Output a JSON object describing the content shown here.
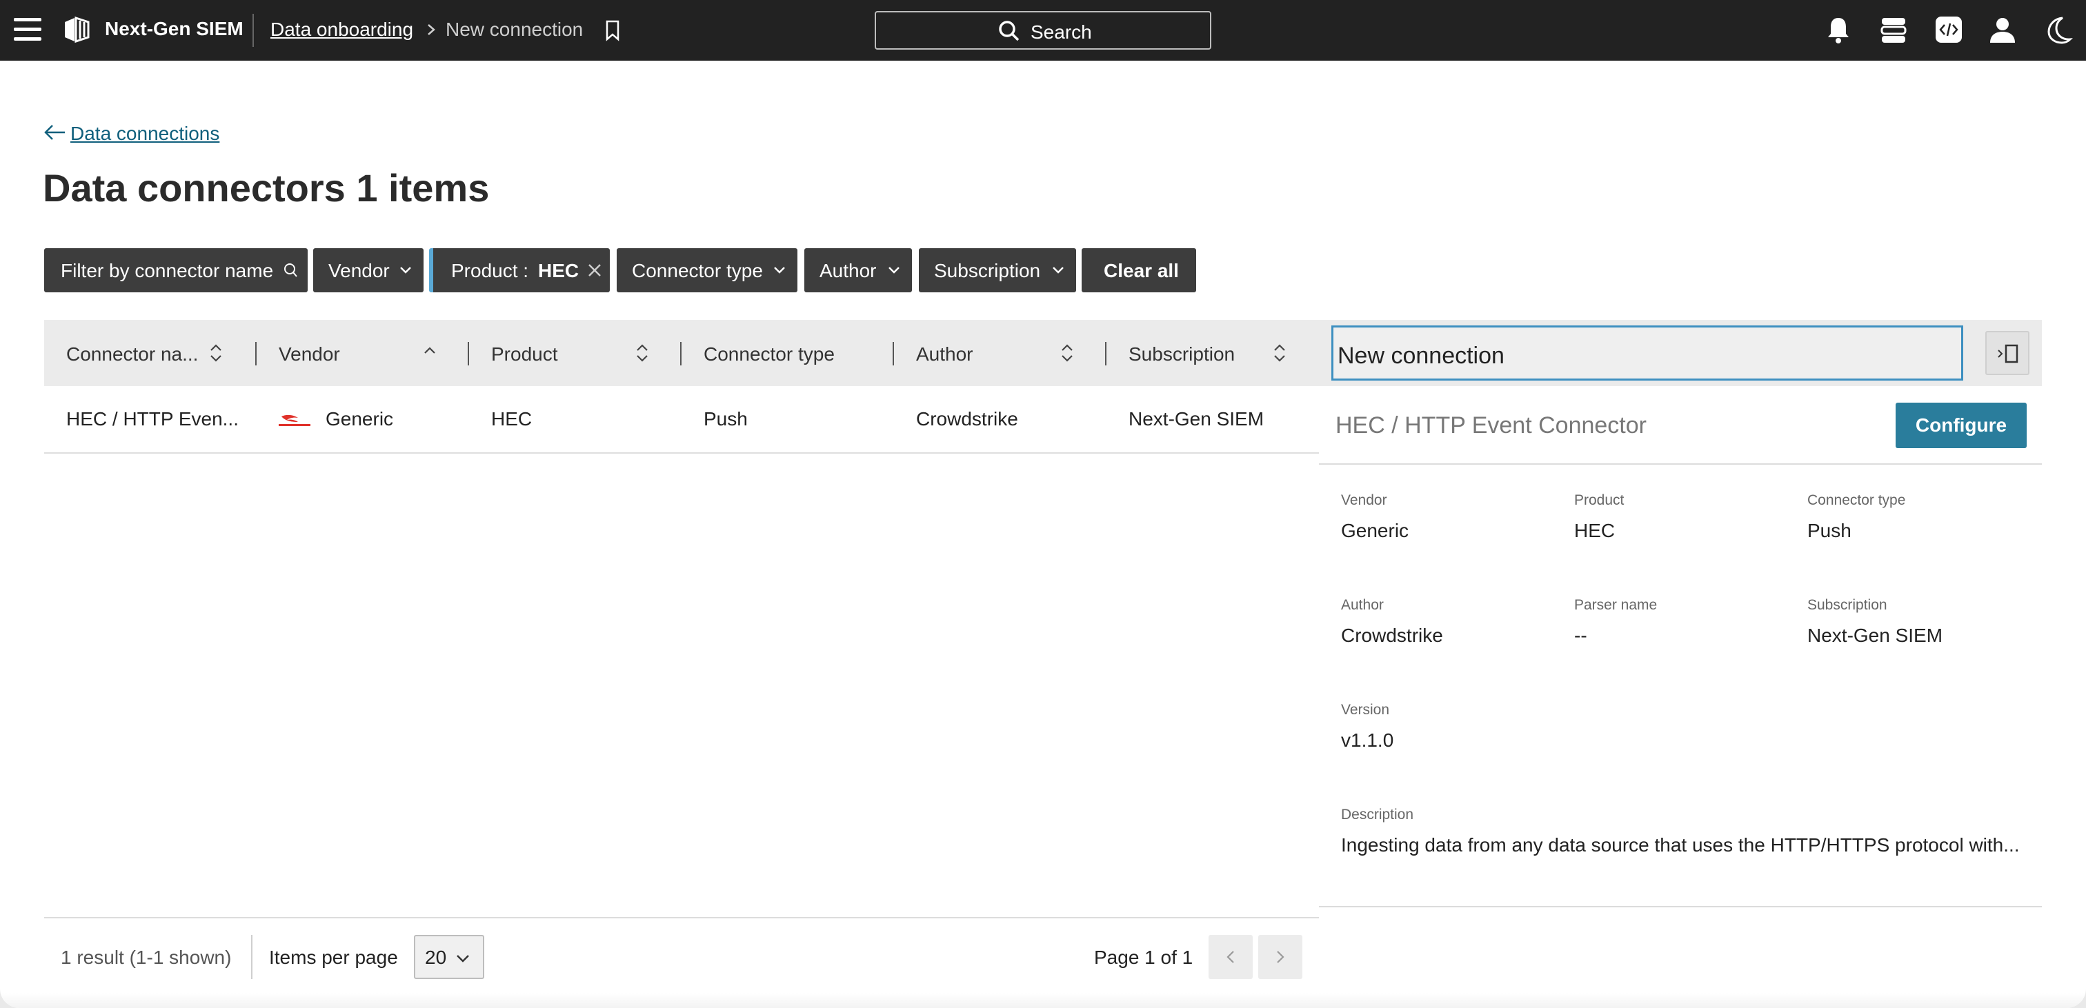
{
  "topbar": {
    "app_name": "Next-Gen SIEM",
    "breadcrumb_link": "Data onboarding",
    "breadcrumb_current": "New connection",
    "search_label": "Search",
    "icons": [
      "menu-icon",
      "app-logo-icon",
      "chevron-right-icon",
      "bookmark-icon",
      "search-icon",
      "bell-icon",
      "stack-icon",
      "code-icon",
      "user-icon",
      "moon-icon"
    ]
  },
  "back_link": "Data connections",
  "page_title": "Data connectors 1 items",
  "filters": {
    "connector_name": "Filter by connector name",
    "vendor": "Vendor",
    "product_label": "Product :",
    "product_value": "HEC",
    "connector_type": "Connector type",
    "author": "Author",
    "subscription": "Subscription",
    "clear_all": "Clear all"
  },
  "table": {
    "columns": [
      "Connector na...",
      "Vendor",
      "Product",
      "Connector type",
      "Author",
      "Subscription"
    ],
    "rows": [
      {
        "connector_name": "HEC / HTTP Even...",
        "vendor": "Generic",
        "product": "HEC",
        "connector_type": "Push",
        "author": "Crowdstrike",
        "subscription": "Next-Gen SIEM"
      }
    ]
  },
  "pagination": {
    "result": "1 result (1-1 shown)",
    "items_per_page_label": "Items per page",
    "items_per_page_value": "20",
    "page_label": "Page 1 of 1"
  },
  "panel": {
    "title_input_value": "New connection",
    "subtitle": "HEC / HTTP Event Connector",
    "configure_label": "Configure",
    "fields": {
      "vendor_label": "Vendor",
      "vendor_value": "Generic",
      "product_label": "Product",
      "product_value": "HEC",
      "connector_type_label": "Connector type",
      "connector_type_value": "Push",
      "author_label": "Author",
      "author_value": "Crowdstrike",
      "parser_label": "Parser name",
      "parser_value": "--",
      "subscription_label": "Subscription",
      "subscription_value": "Next-Gen SIEM",
      "version_label": "Version",
      "version_value": "v1.1.0",
      "description_label": "Description",
      "description_value": "Ingesting data from any data source that uses the HTTP/HTTPS protocol with..."
    }
  },
  "colors": {
    "topbar_bg": "#222222",
    "accent": "#2a7d9c",
    "link": "#0f5f7c",
    "filter_bg": "#3d3d3d",
    "input_focus": "#3d8fc0",
    "vendor_logo": "#e0312a"
  }
}
